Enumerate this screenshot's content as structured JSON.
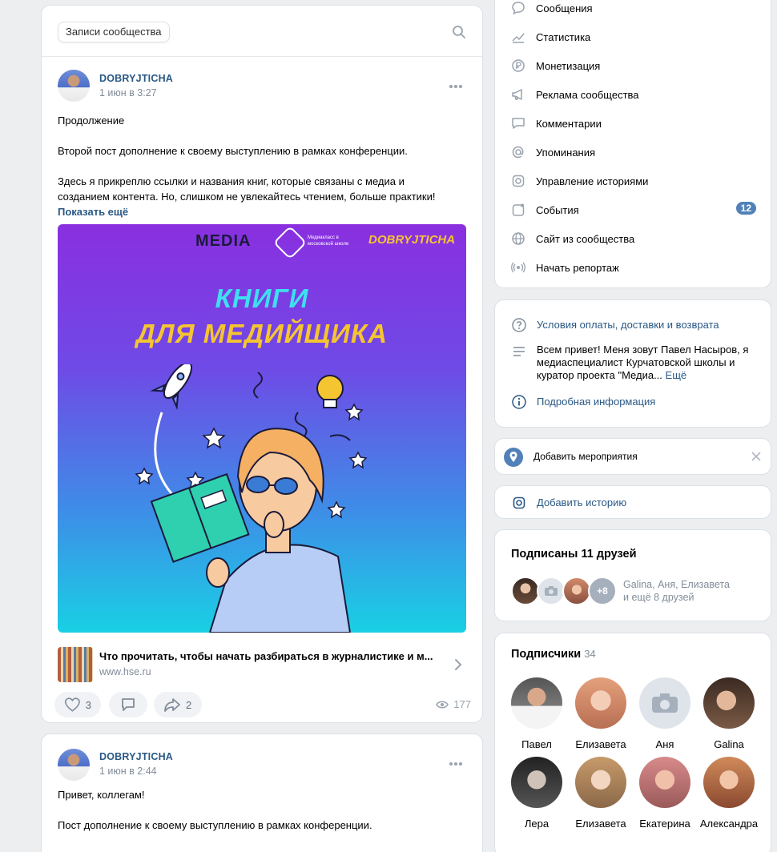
{
  "tabs": {
    "active": "Записи сообщества"
  },
  "posts": [
    {
      "author": "DOBRYJTICHA",
      "time": "1 июн в 3:27",
      "lines": [
        "Продолжение",
        "Второй пост дополнение к своему выступлению в рамках конференции.",
        "Здесь я прикреплю ссылки и названия книг, которые связаны с медиа и",
        "созданием контента. Но, слишком не увлекайтесь чтением, больше практики!"
      ],
      "show_more": "Показать ещё",
      "image": {
        "logo_media": "MEDIA",
        "logo_mediaclass": "Медиакласс в московской школе",
        "logo_dobry": "DOBRYJTICHA",
        "title_line1": "КНИГИ",
        "title_line2": "ДЛЯ МЕДИЙЩИКА"
      },
      "link": {
        "title": "Что прочитать, чтобы начать разбираться в журналистике и м...",
        "url": "www.hse.ru"
      },
      "likes": "3",
      "shares": "2",
      "views": "177"
    },
    {
      "author": "DOBRYJTICHA",
      "time": "1 июн в 2:44",
      "lines": [
        "Привет, коллегам!",
        "Пост дополнение к своему выступлению в рамках конференции."
      ]
    }
  ],
  "menu": [
    {
      "label": "Сообщения",
      "icon": "message-icon"
    },
    {
      "label": "Статистика",
      "icon": "stats-icon"
    },
    {
      "label": "Монетизация",
      "icon": "ruble-icon"
    },
    {
      "label": "Реклама сообщества",
      "icon": "megaphone-icon"
    },
    {
      "label": "Комментарии",
      "icon": "comment-icon"
    },
    {
      "label": "Упоминания",
      "icon": "at-icon"
    },
    {
      "label": "Управление историями",
      "icon": "stories-icon"
    },
    {
      "label": "События",
      "icon": "events-icon",
      "badge": "12"
    },
    {
      "label": "Сайт из сообщества",
      "icon": "globe-icon"
    },
    {
      "label": "Начать репортаж",
      "icon": "broadcast-icon"
    }
  ],
  "info": {
    "payment_link": "Условия оплаты, доставки и возврата",
    "description_l1": "Всем привет! Меня зовут Павел Насыров, я",
    "description_l2": "медиаспециалист Курчатовской школы и",
    "description_l3": "куратор проекта \"Медиа...",
    "more": "Ещё",
    "details_link": "Подробная информация"
  },
  "event": {
    "label": "Добавить мероприятия"
  },
  "story": {
    "label": "Добавить историю"
  },
  "friends": {
    "title": "Подписаны 11 друзей",
    "more_count": "+8",
    "names": "Galina, Аня, Елизавета",
    "rest": "и ещё 8 друзей"
  },
  "subscribers": {
    "title": "Подписчики",
    "count": "34",
    "people": [
      "Павел",
      "Елизавета",
      "Аня",
      "Galina",
      "Лера",
      "Елизавета",
      "Екатерина",
      "Александра"
    ]
  },
  "colors": {
    "link": "#2a5885",
    "badge": "#5181b8",
    "accent_yellow": "#f5c531",
    "accent_cyan": "#3ee0f0"
  }
}
